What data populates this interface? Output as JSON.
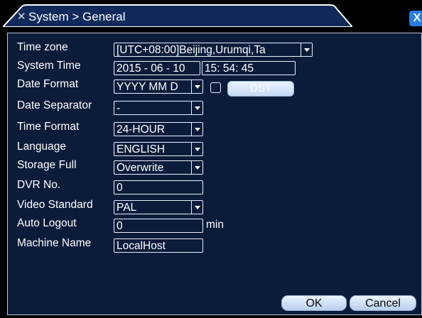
{
  "window": {
    "title": "System > General",
    "close_label": "X"
  },
  "colors": {
    "panel_bg": "#0b1c3a",
    "panel_border": "#b7c7e6",
    "text": "#ffffff",
    "button_gradient_top": "#eaf3ff",
    "button_gradient_bottom": "#b8cfee",
    "close_button": "#2b7de0"
  },
  "icons": {
    "title": "tools-icon",
    "dropdown": "chevron-down-icon"
  },
  "form": {
    "time_zone": {
      "label": "Time zone",
      "value": "[UTC+08:00]Beijing,Urumqi,Ta"
    },
    "system_time": {
      "label": "System Time",
      "date": "2015 - 06 - 10",
      "time": "15: 54: 45"
    },
    "date_format": {
      "label": "Date Format",
      "value": "YYYY MM D",
      "dst_label": "DST"
    },
    "date_separator": {
      "label": "Date Separator",
      "value": "-"
    },
    "time_format": {
      "label": "Time Format",
      "value": "24-HOUR"
    },
    "language": {
      "label": "Language",
      "value": "ENGLISH"
    },
    "storage_full": {
      "label": "Storage Full",
      "value": "Overwrite"
    },
    "dvr_no": {
      "label": "DVR No.",
      "value": "0"
    },
    "video_standard": {
      "label": "Video Standard",
      "value": "PAL"
    },
    "auto_logout": {
      "label": "Auto Logout",
      "value": "0",
      "unit": "min"
    },
    "machine_name": {
      "label": "Machine Name",
      "value": "LocalHost"
    }
  },
  "buttons": {
    "ok": "OK",
    "cancel": "Cancel"
  }
}
